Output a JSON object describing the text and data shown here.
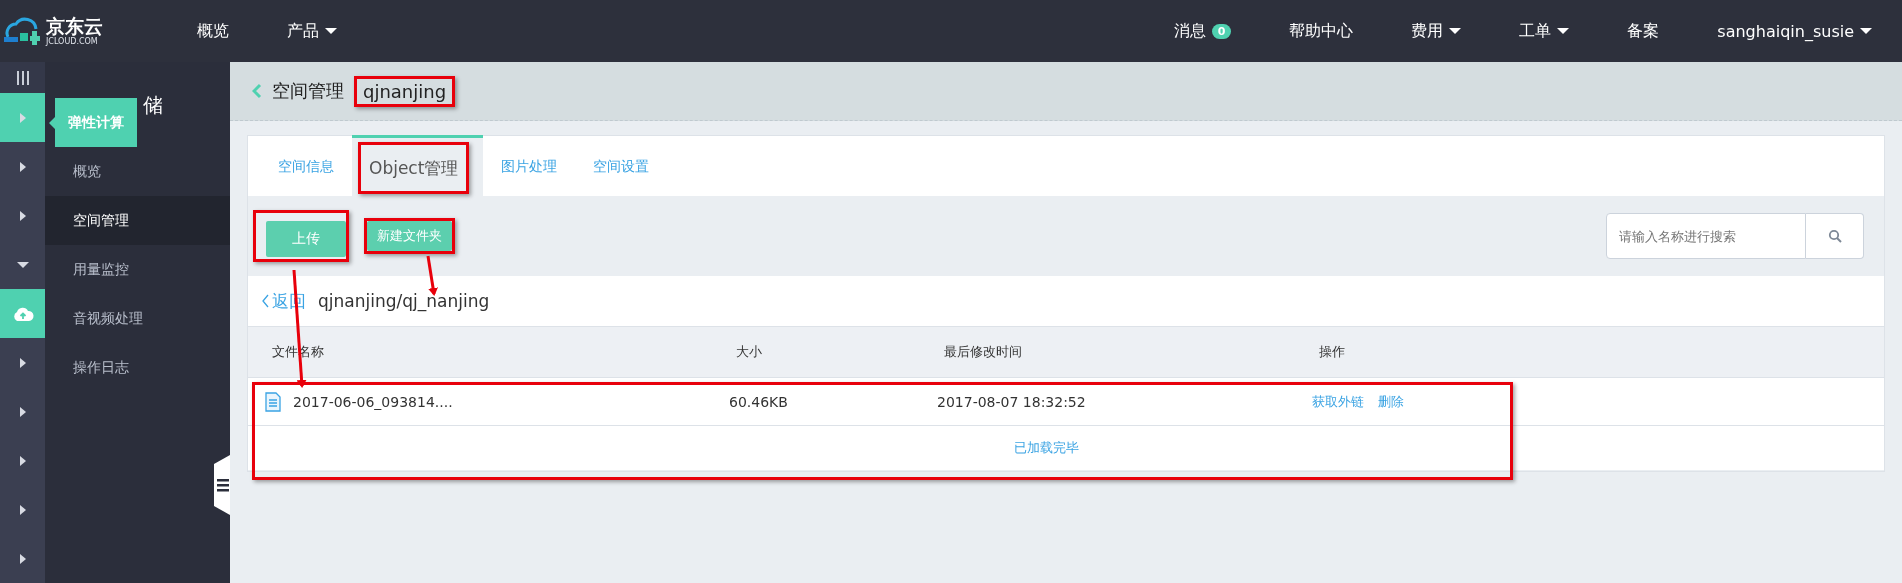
{
  "header": {
    "logo": {
      "name": "京东云",
      "domain": "JCLOUD.COM"
    },
    "nav_left": [
      {
        "label": "概览",
        "dropdown": false
      },
      {
        "label": "产品",
        "dropdown": true
      }
    ],
    "nav_right": [
      {
        "label": "消息",
        "badge": "0",
        "dropdown": false
      },
      {
        "label": "帮助中心",
        "dropdown": false
      },
      {
        "label": "费用",
        "dropdown": true
      },
      {
        "label": "工单",
        "dropdown": true
      },
      {
        "label": "备案",
        "dropdown": false
      },
      {
        "label": "sanghaiqin_susie",
        "dropdown": true
      }
    ]
  },
  "rail": {
    "items": [
      {
        "kind": "arrow",
        "selected": true
      },
      {
        "kind": "arrow",
        "selected": false
      },
      {
        "kind": "arrow",
        "selected": false
      },
      {
        "kind": "caret",
        "selected": false
      },
      {
        "kind": "cloud",
        "selected": true
      },
      {
        "kind": "arrow",
        "selected": false
      },
      {
        "kind": "arrow",
        "selected": false
      },
      {
        "kind": "arrow",
        "selected": false
      },
      {
        "kind": "arrow",
        "selected": false
      },
      {
        "kind": "arrow",
        "selected": false
      }
    ]
  },
  "sidebar": {
    "title": "储",
    "tooltip": "弹性计算",
    "items": [
      {
        "label": "概览",
        "selected": false
      },
      {
        "label": "空间管理",
        "selected": true
      },
      {
        "label": "用量监控",
        "selected": false
      },
      {
        "label": "音视频处理",
        "selected": false
      },
      {
        "label": "操作日志",
        "selected": false
      }
    ]
  },
  "page": {
    "title": "空间管理",
    "bucket": "qjnanjing"
  },
  "tabs": [
    {
      "label": "空间信息",
      "selected": false
    },
    {
      "label": "Object管理",
      "selected": true
    },
    {
      "label": "图片处理",
      "selected": false
    },
    {
      "label": "空间设置",
      "selected": false
    }
  ],
  "toolbar": {
    "buttons": [
      "上传",
      "新建文件夹"
    ],
    "search": {
      "placeholder": "请输入名称进行搜索"
    }
  },
  "path": {
    "back": "返回",
    "current": "qjnanjing/qj_nanjing"
  },
  "table": {
    "columns": [
      "文件名称",
      "大小",
      "最后修改时间",
      "操作"
    ],
    "rows": [
      {
        "name": "2017-06-06_093814....",
        "size": "60.46KB",
        "modified": "2017-08-07 18:32:52",
        "actions": [
          "获取外链",
          "删除"
        ]
      }
    ],
    "footer": "已加载完毕"
  }
}
